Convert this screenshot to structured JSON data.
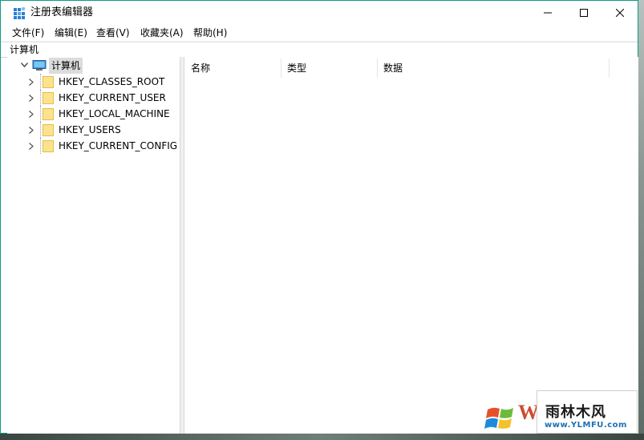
{
  "window": {
    "title": "注册表编辑器",
    "accent_color": "#0f9d84"
  },
  "menu": {
    "items": [
      "文件(F)",
      "编辑(E)",
      "查看(V)",
      "收藏夹(A)",
      "帮助(H)"
    ]
  },
  "address": {
    "path": "计算机"
  },
  "tree": {
    "root": {
      "label": "计算机",
      "icon": "computer-icon",
      "expanded": true
    },
    "children": [
      {
        "label": "HKEY_CLASSES_ROOT",
        "icon": "folder-icon"
      },
      {
        "label": "HKEY_CURRENT_USER",
        "icon": "folder-icon"
      },
      {
        "label": "HKEY_LOCAL_MACHINE",
        "icon": "folder-icon"
      },
      {
        "label": "HKEY_USERS",
        "icon": "folder-icon"
      },
      {
        "label": "HKEY_CURRENT_CONFIG",
        "icon": "folder-icon"
      }
    ]
  },
  "list": {
    "columns": [
      "名称",
      "类型",
      "数据"
    ]
  },
  "watermark": {
    "prefix": "W",
    "site_name": "雨林木风",
    "site_url": "www.YLMFU.com"
  }
}
